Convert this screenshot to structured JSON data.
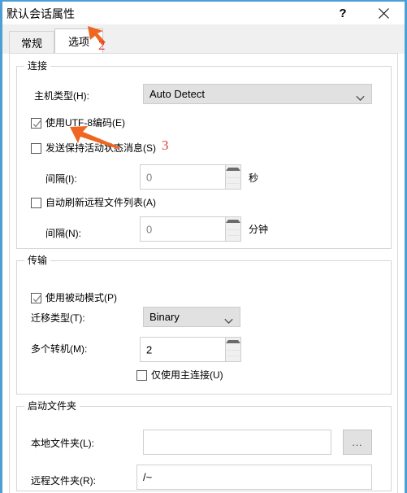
{
  "window": {
    "title": "默认会话属性",
    "help_label": "?",
    "close_label": "✕",
    "accent_color": "#4a9fd5"
  },
  "tabs": [
    {
      "label": "常规",
      "active": false
    },
    {
      "label": "选项",
      "active": true
    }
  ],
  "groups": {
    "connection": {
      "title": "连接",
      "host_type": {
        "label": "主机类型(H):",
        "value": "Auto Detect"
      },
      "use_utf8": {
        "label": "使用UTF-8编码(E)",
        "checked": true
      },
      "send_keepalive": {
        "label": "发送保持活动状态消息(S)",
        "checked": false
      },
      "keepalive_interval": {
        "label": "间隔(I):",
        "value": "0",
        "unit": "秒"
      },
      "auto_refresh": {
        "label": "自动刷新远程文件列表(A)",
        "checked": false
      },
      "refresh_interval": {
        "label": "间隔(N):",
        "value": "0",
        "unit": "分钟"
      }
    },
    "transfer": {
      "title": "传输",
      "passive_mode": {
        "label": "使用被动模式(P)",
        "checked": true
      },
      "transfer_type": {
        "label": "迁移类型(T):",
        "value": "Binary"
      },
      "multiple_transfers": {
        "label": "多个转机(M):",
        "value": "2"
      },
      "main_connection_only": {
        "label": "仅使用主连接(U)",
        "checked": false
      }
    },
    "startup": {
      "title": "启动文件夹",
      "local_folder": {
        "label": "本地文件夹(L):",
        "value": "",
        "browse_label": "..."
      },
      "remote_folder": {
        "label": "远程文件夹(R):",
        "value": "/~"
      }
    }
  },
  "annotations": {
    "step2": "2",
    "step3": "3",
    "arrow_color": "#ee6622",
    "number_color": "#e03a3a"
  }
}
